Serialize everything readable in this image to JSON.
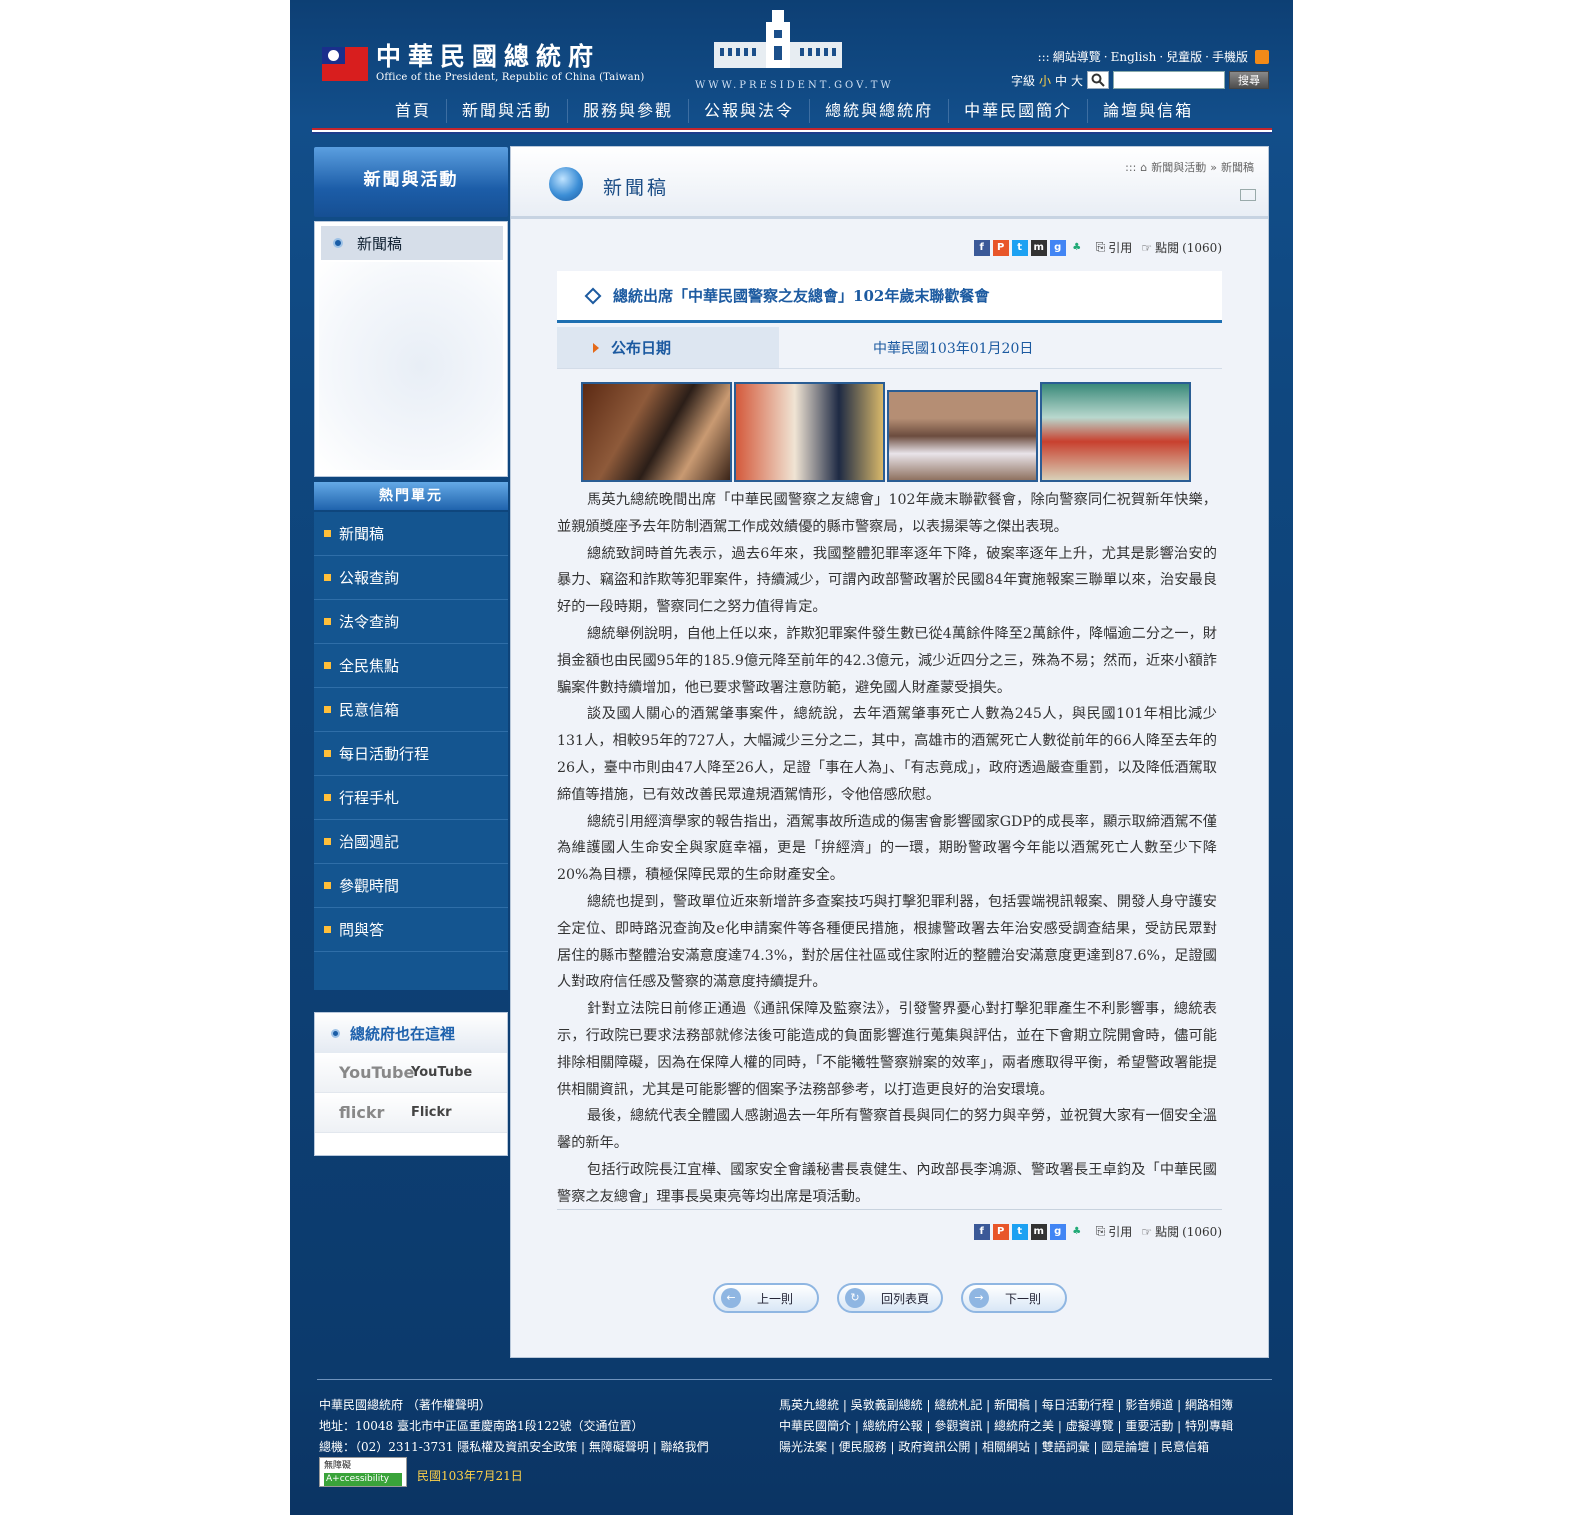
{
  "header": {
    "title_cn": "中華民國總統府",
    "title_en": "Office of the President, Republic of China (Taiwan)",
    "site_url": "WWW.PRESIDENT.GOV.TW",
    "top_links": [
      "網站導覽",
      "English",
      "兒童版",
      "手機版"
    ],
    "font_size_label": "字級",
    "font_sizes": [
      "小",
      "中",
      "大"
    ],
    "search_placeholder": "",
    "search_button": "搜尋",
    "nav": [
      "首頁",
      "新聞與活動",
      "服務與參觀",
      "公報與法令",
      "總統與總統府",
      "中華民國簡介",
      "論壇與信箱"
    ]
  },
  "sidebar": {
    "section_title": "新聞與活動",
    "sub_items": [
      "新聞稿"
    ],
    "hot_title": "熱門單元",
    "hot_items": [
      "新聞稿",
      "公報查詢",
      "法令查詢",
      "全民焦點",
      "民意信箱",
      "每日活動行程",
      "行程手札",
      "治國週記",
      "參觀時間",
      "問與答"
    ],
    "also_title": "總統府也在這裡",
    "also_items": [
      {
        "logo": "YouTube",
        "name": "YouTube"
      },
      {
        "logo": "flickr",
        "name": "Flickr"
      }
    ]
  },
  "content": {
    "page_title": "新聞稿",
    "breadcrumb": [
      ":::",
      "新聞與活動",
      "»",
      "新聞稿"
    ],
    "share": {
      "cite": "引用",
      "views_label": "點閱",
      "views": "(1060)"
    },
    "article_title": "總統出席「中華民國警察之友總會」102年歲末聯歡餐會",
    "date_label": "公布日期",
    "date_value": "中華民國103年01月20日",
    "paragraphs": [
      "馬英九總統晚間出席「中華民國警察之友總會」102年歲末聯歡餐會，除向警察同仁祝賀新年快樂，並親頒獎座予去年防制酒駕工作成效績優的縣市警察局，以表揚渠等之傑出表現。",
      "總統致詞時首先表示，過去6年來，我國整體犯罪率逐年下降，破案率逐年上升，尤其是影響治安的暴力、竊盜和詐欺等犯罪案件，持續減少，可謂內政部警政署於民國84年實施報案三聯單以來，治安最良好的一段時期，警察同仁之努力值得肯定。",
      "總統舉例說明，自他上任以來，詐欺犯罪案件發生數已從4萬餘件降至2萬餘件，降幅逾二分之一，財損金額也由民國95年的185.9億元降至前年的42.3億元，減少近四分之三，殊為不易；然而，近來小額詐騙案件數持續增加，他已要求警政署注意防範，避免國人財產蒙受損失。",
      "談及國人關心的酒駕肇事案件，總統說，去年酒駕肇事死亡人數為245人，與民國101年相比減少131人，相較95年的727人，大幅減少三分之二，其中，高雄市的酒駕死亡人數從前年的66人降至去年的26人，臺中市則由47人降至26人，足證「事在人為」、「有志竟成」，政府透過嚴查重罰，以及降低酒駕取締值等措施，已有效改善民眾違規酒駕情形，令他倍感欣慰。",
      "總統引用經濟學家的報告指出，酒駕事故所造成的傷害會影響國家GDP的成長率，顯示取締酒駕不僅為維護國人生命安全與家庭幸福，更是「拚經濟」的一環，期盼警政署今年能以酒駕死亡人數至少下降20%為目標，積極保障民眾的生命財產安全。",
      "總統也提到，警政單位近來新增許多查案技巧與打擊犯罪利器，包括雲端視訊報案、開發人身守護安全定位、即時路況查詢及e化申請案件等各種便民措施，根據警政署去年治安感受調查結果，受訪民眾對居住的縣市整體治安滿意度達74.3%，對於居住社區或住家附近的整體治安滿意度更達到87.6%，足證國人對政府信任感及警察的滿意度持續提升。",
      "針對立法院日前修正通過《通訊保障及監察法》，引發警界憂心對打擊犯罪產生不利影響事，總統表示，行政院已要求法務部就修法後可能造成的負面影響進行蒐集與評估，並在下會期立院開會時，儘可能排除相關障礙，因為在保障人權的同時，「不能犧牲警察辦案的效率」，兩者應取得平衡，希望警政署能提供相關資訊，尤其是可能影響的個案予法務部參考，以打造更良好的治安環境。",
      "最後，總統代表全體國人感謝過去一年所有警察首長與同仁的努力與辛勞，並祝賀大家有一個安全溫馨的新年。",
      "包括行政院長江宜樺、國家安全會議秘書長袁健生、內政部長李鴻源、警政署長王卓鈞及「中華民國警察之友總會」理事長吳東亮等均出席是項活動。"
    ],
    "pager": [
      "上一則",
      "回列表頁",
      "下一則"
    ]
  },
  "footer": {
    "line1": "中華民國總統府 （著作權聲明）",
    "line2": "地址：10048 臺北市中正區重慶南路1段122號（交通位置）",
    "line3": "總機：（02）2311-3731 隱私權及資訊安全政策 | 無障礙聲明 | 聯絡我們",
    "right1": "馬英九總統 | 吳敦義副總統 | 總統札記 | 新聞稿 | 每日活動行程 | 影音頻道 | 網路相簿",
    "right2": "中華民國簡介 | 總統府公報 | 參觀資訊 | 總統府之美 | 虛擬導覽 | 重要活動 | 特別專輯",
    "right3": "陽光法案 | 便民服務 | 政府資訊公開 | 相關網站 | 雙語詞彙 | 國是論壇 | 民意信箱",
    "badge_top": "無障礙",
    "badge_bottom": "A+ccessibility",
    "updated": "民國103年7月21日"
  }
}
